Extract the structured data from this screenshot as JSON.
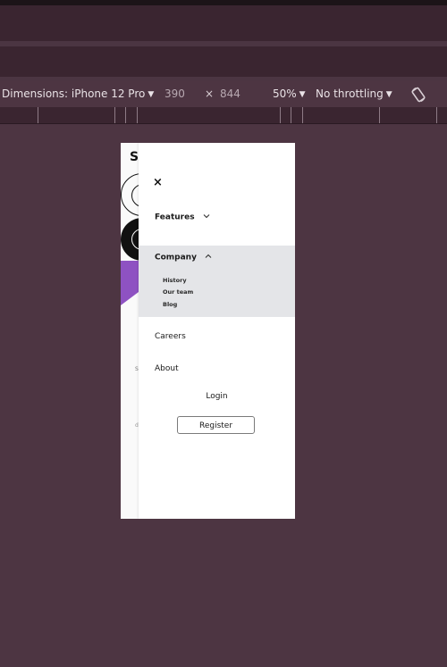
{
  "devtools": {
    "device_label": "Dimensions: iPhone 12 Pro",
    "width": "390",
    "times": "×",
    "height": "844",
    "zoom": "50%",
    "throttling": "No throttling",
    "rotate_icon": "rotate-device-icon",
    "caret_icon": "▼"
  },
  "site": {
    "logo_letter": "S",
    "hidden_text_1": "S",
    "hidden_text_2": "d"
  },
  "menu": {
    "close_symbol": "×",
    "features_label": "Features",
    "company_label": "Company",
    "company_children": [
      "History",
      "Our team",
      "Blog"
    ],
    "careers_label": "Careers",
    "about_label": "About",
    "login_label": "Login",
    "register_label": "Register"
  },
  "colors": {
    "devtools_bg": "#4d3542",
    "panel_highlight": "#e4e5e8",
    "accent_purple": "#8e52c2"
  }
}
